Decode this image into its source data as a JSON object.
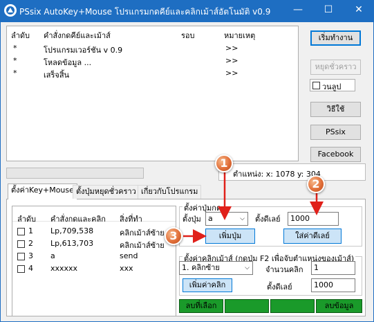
{
  "window": {
    "title": "PSsix AutoKey+Mouse โปรแกรมกดคีย์และคลิกเม้าส์อัตโนมัติ v0.9",
    "minimize": "—",
    "maximize": "☐",
    "close": "✕"
  },
  "top_list": {
    "headers": [
      "ลำดับ",
      "คำสั่งกดคีย์และเม้าส์",
      "รอบ",
      "หมายเหตุ"
    ],
    "rows": [
      {
        "order": "*",
        "command": "โปรแกรมเวอร์ชัน v 0.9",
        "rounds": "",
        "note": ">>"
      },
      {
        "order": "*",
        "command": "โหลดข้อมูล ...",
        "rounds": "",
        "note": ">>"
      },
      {
        "order": "*",
        "command": "เสร็จสิ้น",
        "rounds": "",
        "note": ">>"
      }
    ]
  },
  "side_buttons": {
    "start": "เริ่มทำงาน",
    "pause": "หยุดชั่วคราว",
    "loop": "วนลูป",
    "howto": "วิธีใช้",
    "pssix": "PSsix",
    "facebook": "Facebook"
  },
  "status": {
    "position_label": "ตำแหน่ง: x: 1078 y: 304"
  },
  "tabs": [
    {
      "label": "ตั้งค่าKey+Mouse",
      "active": true
    },
    {
      "label": "ตั้งปุ่มหยุดชั่วคราว",
      "active": false
    },
    {
      "label": "เกี่ยวกับโปรแกรม",
      "active": false
    }
  ],
  "inner_list": {
    "headers": [
      "ลำดับ",
      "คำสั่งกดและคลิก",
      "สิ่งที่ทำ"
    ],
    "rows": [
      {
        "order": "1",
        "command": "Lp,709,538",
        "action": "คลิกเม้าส์ซ้าย"
      },
      {
        "order": "2",
        "command": "Lp,613,703",
        "action": "คลิกเม้าส์ซ้าย"
      },
      {
        "order": "3",
        "command": "a",
        "action": "send"
      },
      {
        "order": "4",
        "command": "xxxxxx",
        "action": "xxx"
      }
    ]
  },
  "key_group": {
    "title": "ตั้งค่าปุ่มกด",
    "key_label": "ตั้งปุ่ม",
    "key_value": "a",
    "delay_label": "ตั้งดีเลย์",
    "delay_value": "1000",
    "add_key_button": "เพิ่มปุ่ม",
    "set_delay_button": "ใส่ค่าดีเลย์"
  },
  "click_group": {
    "title": "ตั้งค่าคลิกเม้าส์ (กดปุ่ม F2 เพื่อจับตำแหน่งของเม้าส์)",
    "click_type": "1. คลิกซ้าย",
    "count_label": "จำนวนคลิก",
    "count_value": "1",
    "add_click_button": "เพิ่มค่าคลิก",
    "delay_label": "ตั้งดีเลย์",
    "delay_value": "1000"
  },
  "bottom_buttons": {
    "delete_selected": "ลบที่เลือก",
    "blank1": "",
    "blank2": "",
    "delete_all": "ลบข้อมูล"
  },
  "markers": [
    "1",
    "2",
    "3"
  ],
  "colors": {
    "title_bar": "#1e6ec2",
    "accent_blue": "#0078d7",
    "green_button": "#1a9a2a",
    "marker_orange": "#e2703a",
    "arrow_red": "#e0201a"
  }
}
